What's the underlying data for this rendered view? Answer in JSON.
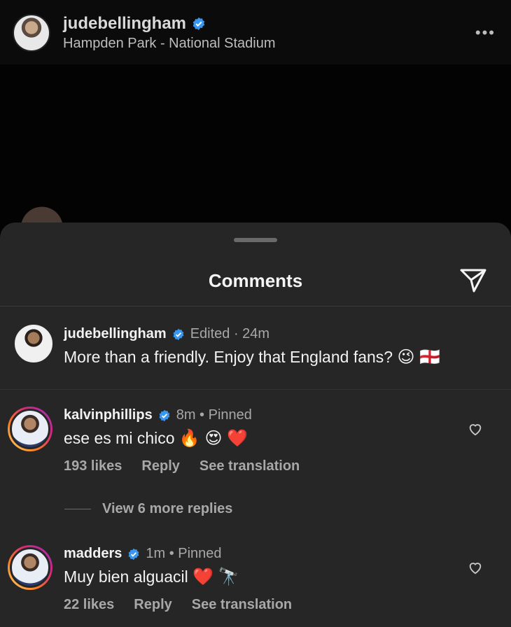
{
  "post": {
    "username": "judebellingham",
    "location": "Hampden Park - National Stadium",
    "more": "•••"
  },
  "sheet": {
    "title": "Comments"
  },
  "caption": {
    "username": "judebellingham",
    "meta": "Edited · 24m",
    "text": "More than a friendly. Enjoy that England fans?",
    "emojis": "😉 🏴󠁧󠁢󠁥󠁮󠁧󠁿"
  },
  "comments": [
    {
      "username": "kalvinphillips",
      "meta": "8m • Pinned",
      "text": "ese es mi chico",
      "emojis": "🔥 😍 ❤️",
      "likes": "193 likes",
      "reply": "Reply",
      "translate": "See translation",
      "view_replies": "View 6 more replies"
    },
    {
      "username": "madders",
      "meta": "1m • Pinned",
      "text": "Muy bien alguacil",
      "emojis": "❤️ 🔭",
      "likes": "22 likes",
      "reply": "Reply",
      "translate": "See translation"
    }
  ],
  "colors": {
    "verified": "#3897f0",
    "sheet_bg": "#262626",
    "meta_text": "#a8a8a8"
  },
  "icons": [
    "verified-badge-icon",
    "more-options-icon",
    "share-icon",
    "heart-icon"
  ]
}
